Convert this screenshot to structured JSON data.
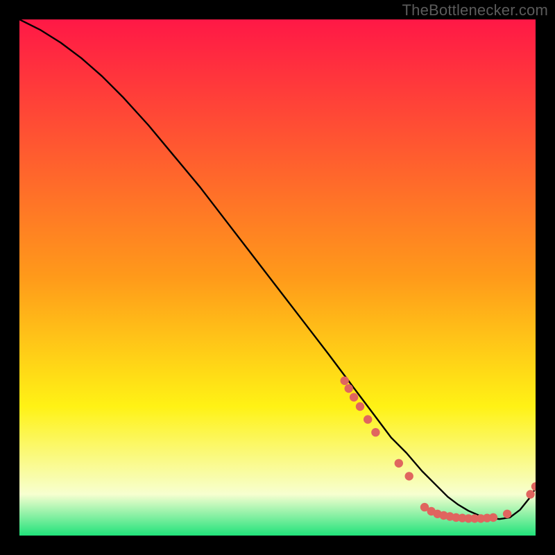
{
  "watermark": "TheBottlenecker.com",
  "colors": {
    "top": "#ff1846",
    "mid_orange": "#ff9a1a",
    "yellow": "#fff215",
    "pale": "#f7ffd0",
    "green": "#20e27a",
    "curve": "#000000",
    "dot": "#e0655f"
  },
  "chart_data": {
    "type": "line",
    "title": "",
    "xlabel": "",
    "ylabel": "",
    "xlim": [
      0,
      100
    ],
    "ylim": [
      0,
      100
    ],
    "curve": {
      "x": [
        0,
        4,
        8,
        12,
        16,
        20,
        25,
        30,
        35,
        40,
        45,
        50,
        55,
        60,
        63,
        66,
        69,
        72,
        75,
        78,
        81,
        83,
        85,
        87,
        90,
        93,
        95,
        97,
        99,
        100
      ],
      "y": [
        100,
        98,
        95.5,
        92.5,
        89,
        85,
        79.5,
        73.5,
        67.5,
        61,
        54.5,
        48,
        41.5,
        35,
        31,
        27,
        23,
        19,
        16,
        12.5,
        9.5,
        7.5,
        6,
        4.8,
        3.5,
        3.2,
        3.5,
        5.0,
        7.5,
        9.2
      ]
    },
    "dots": [
      {
        "x": 63.0,
        "y": 30.0
      },
      {
        "x": 63.8,
        "y": 28.5
      },
      {
        "x": 64.8,
        "y": 26.8
      },
      {
        "x": 66.0,
        "y": 25.0
      },
      {
        "x": 67.5,
        "y": 22.5
      },
      {
        "x": 69.0,
        "y": 20.0
      },
      {
        "x": 73.5,
        "y": 14.0
      },
      {
        "x": 75.5,
        "y": 11.5
      },
      {
        "x": 78.5,
        "y": 5.5
      },
      {
        "x": 79.8,
        "y": 4.7
      },
      {
        "x": 81.0,
        "y": 4.2
      },
      {
        "x": 82.2,
        "y": 3.9
      },
      {
        "x": 83.4,
        "y": 3.7
      },
      {
        "x": 84.6,
        "y": 3.5
      },
      {
        "x": 85.8,
        "y": 3.4
      },
      {
        "x": 87.0,
        "y": 3.3
      },
      {
        "x": 88.2,
        "y": 3.3
      },
      {
        "x": 89.4,
        "y": 3.3
      },
      {
        "x": 90.6,
        "y": 3.4
      },
      {
        "x": 91.8,
        "y": 3.5
      },
      {
        "x": 94.5,
        "y": 4.2
      },
      {
        "x": 99.0,
        "y": 8.0
      },
      {
        "x": 100.0,
        "y": 9.5
      }
    ]
  }
}
